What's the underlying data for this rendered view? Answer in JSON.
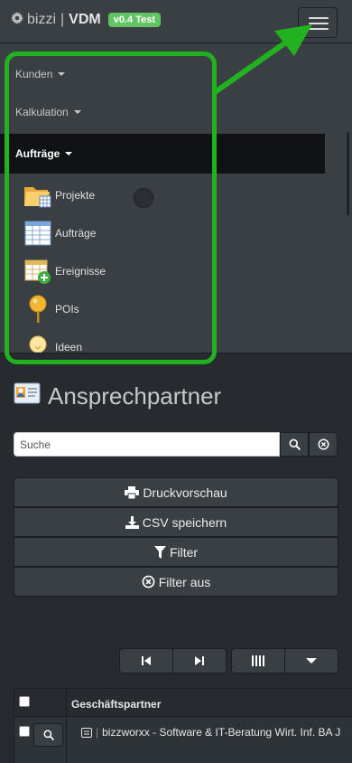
{
  "navbar": {
    "app_name": "bizzi",
    "module_name": "VDM",
    "version_badge": "v0.4 Test",
    "colors": {
      "badge": "#62c462",
      "background": "#3a3f44"
    }
  },
  "menu": {
    "top_items": [
      {
        "label": "Kunden"
      },
      {
        "label": "Kalkulation"
      },
      {
        "label": "Aufträge"
      }
    ],
    "sub_items": [
      {
        "label": "Projekte",
        "icon": "folder-icon"
      },
      {
        "label": "Aufträge",
        "icon": "table-icon"
      },
      {
        "label": "Ereignisse",
        "icon": "calendar-add-icon"
      },
      {
        "label": "POIs",
        "icon": "pin-icon"
      },
      {
        "label": "Ideen",
        "icon": "lightbulb-icon"
      }
    ]
  },
  "annotation": {
    "color": "#22b11f"
  },
  "page": {
    "title": "Ansprechpartner",
    "title_icon": "contact-card-icon",
    "search": {
      "placeholder": "Suche",
      "value": ""
    },
    "actions": {
      "print": "Druckvorschau",
      "csv": "CSV speichern",
      "filter": "Filter",
      "filter_off": "Filter aus"
    }
  },
  "table": {
    "columns": [
      "Geschäftspartner"
    ],
    "rows": [
      {
        "partner": "bizzworxx - Software & IT-Beratung Wirt. Inf. BA J"
      }
    ]
  }
}
